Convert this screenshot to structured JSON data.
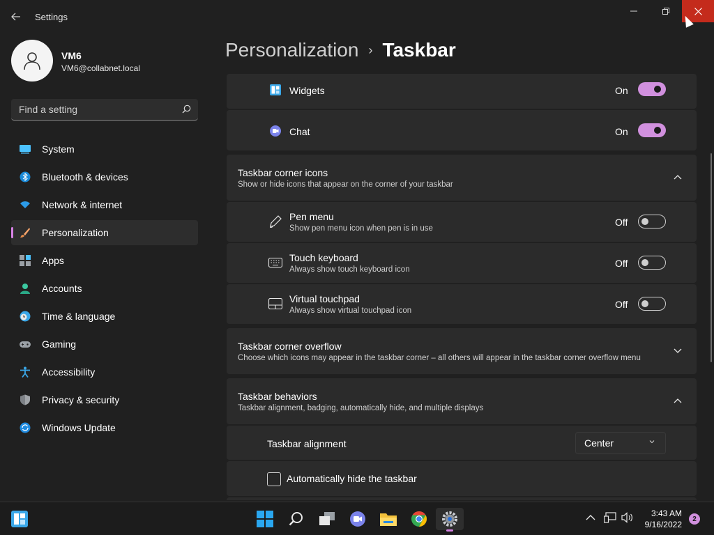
{
  "window": {
    "title": "Settings",
    "back_icon": "back-arrow-icon",
    "minimize_icon": "minimize-icon",
    "maximize_icon": "restore-icon",
    "close_icon": "close-icon",
    "close_color": "#c42b1c"
  },
  "user": {
    "name": "VM6",
    "email": "VM6@collabnet.local"
  },
  "search": {
    "placeholder": "Find a setting"
  },
  "sidebar": {
    "items": [
      {
        "label": "System",
        "icon": "monitor-icon"
      },
      {
        "label": "Bluetooth & devices",
        "icon": "bluetooth-icon"
      },
      {
        "label": "Network & internet",
        "icon": "wifi-icon"
      },
      {
        "label": "Personalization",
        "icon": "paintbrush-icon",
        "active": true
      },
      {
        "label": "Apps",
        "icon": "apps-icon"
      },
      {
        "label": "Accounts",
        "icon": "person-icon"
      },
      {
        "label": "Time & language",
        "icon": "globe-clock-icon"
      },
      {
        "label": "Gaming",
        "icon": "gamepad-icon"
      },
      {
        "label": "Accessibility",
        "icon": "accessibility-icon"
      },
      {
        "label": "Privacy & security",
        "icon": "shield-icon"
      },
      {
        "label": "Windows Update",
        "icon": "sync-icon"
      }
    ]
  },
  "breadcrumb": {
    "parent": "Personalization",
    "separator": "›",
    "current": "Taskbar"
  },
  "taskbar_items": {
    "widgets": {
      "label": "Widgets",
      "state": "On"
    },
    "chat": {
      "label": "Chat",
      "state": "On"
    }
  },
  "corner_icons": {
    "title": "Taskbar corner icons",
    "desc": "Show or hide icons that appear on the corner of your taskbar",
    "pen_menu": {
      "title": "Pen menu",
      "desc": "Show pen menu icon when pen is in use",
      "state": "Off"
    },
    "touch_keyboard": {
      "title": "Touch keyboard",
      "desc": "Always show touch keyboard icon",
      "state": "Off"
    },
    "virtual_touchpad": {
      "title": "Virtual touchpad",
      "desc": "Always show virtual touchpad icon",
      "state": "Off"
    }
  },
  "corner_overflow": {
    "title": "Taskbar corner overflow",
    "desc": "Choose which icons may appear in the taskbar corner – all others will appear in the taskbar corner overflow menu"
  },
  "behaviors": {
    "title": "Taskbar behaviors",
    "desc": "Taskbar alignment, badging, automatically hide, and multiple displays",
    "alignment": {
      "label": "Taskbar alignment",
      "value": "Center"
    },
    "auto_hide": {
      "label": "Automatically hide the taskbar",
      "checked": false
    }
  },
  "colors": {
    "accent": "#d190de",
    "background": "#202020",
    "card": "#2b2b2b"
  },
  "system_taskbar": {
    "apps": [
      "start-icon",
      "search-icon",
      "task-view-icon",
      "teams-chat-icon",
      "file-explorer-icon",
      "chrome-icon",
      "settings-gear-icon"
    ],
    "time": "3:43 AM",
    "date": "9/16/2022",
    "notification_count": "2"
  }
}
